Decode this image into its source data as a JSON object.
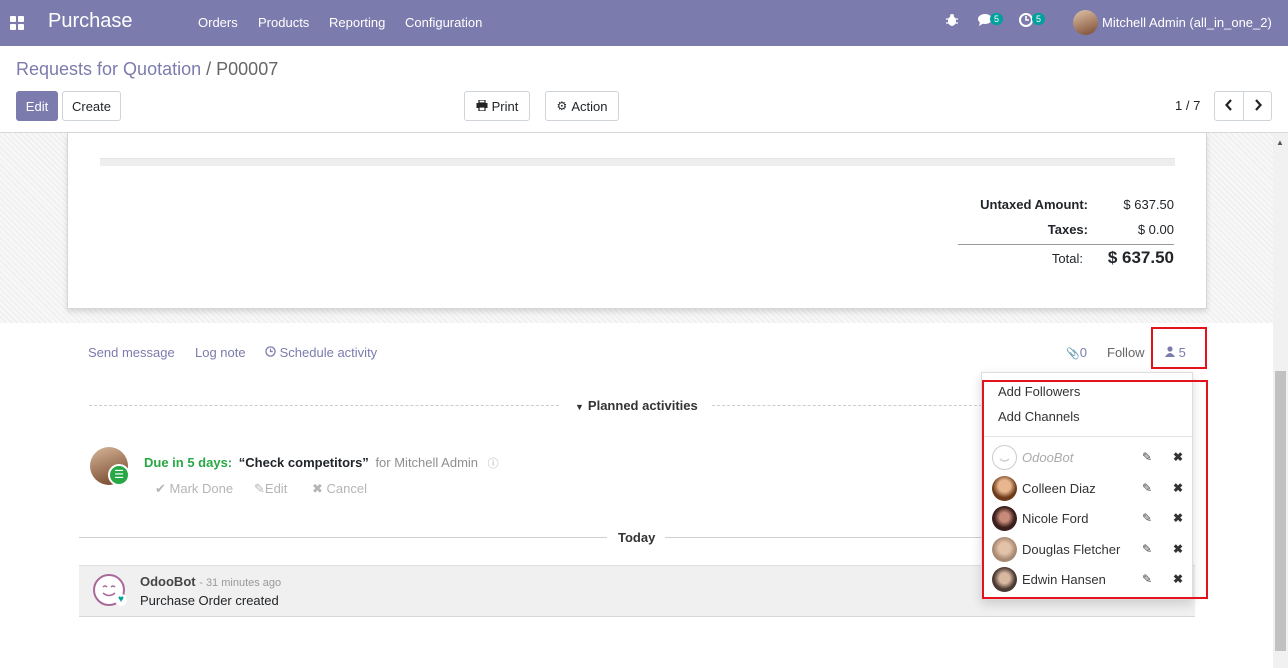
{
  "app": {
    "brand": "Purchase",
    "menu": [
      "Orders",
      "Products",
      "Reporting",
      "Configuration"
    ],
    "messages_count": "5",
    "activities_count": "5",
    "user": "Mitchell Admin (all_in_one_2)"
  },
  "breadcrumb": {
    "parent": "Requests for Quotation",
    "sep": "/",
    "current": "P00007"
  },
  "toolbar": {
    "edit": "Edit",
    "create": "Create",
    "print": "Print",
    "action": "Action",
    "pager": "1 / 7"
  },
  "totals": {
    "untaxed_label": "Untaxed Amount:",
    "untaxed": "$ 637.50",
    "taxes_label": "Taxes:",
    "taxes": "$ 0.00",
    "total_label": "Total:",
    "total": "$ 637.50"
  },
  "chatter": {
    "send": "Send message",
    "log": "Log note",
    "schedule": "Schedule activity",
    "attachments": "0",
    "follow": "Follow",
    "followers": "5"
  },
  "planned": {
    "title": "Planned activities",
    "due": "Due in 5 days:",
    "summary": "“Check competitors”",
    "for": "for Mitchell Admin",
    "mark_done": "Mark Done",
    "edit": "Edit",
    "cancel": "Cancel"
  },
  "today": "Today",
  "message": {
    "author": "OdooBot",
    "time": "- 31 minutes ago",
    "body": "Purchase Order created"
  },
  "followers_menu": {
    "add_followers": "Add Followers",
    "add_channels": "Add Channels",
    "list": [
      "OdooBot",
      "Colleen Diaz",
      "Nicole Ford",
      "Douglas Fletcher",
      "Edwin Hansen"
    ]
  },
  "colors": {
    "brand": "#7c7bad",
    "highlight": "#e4121d",
    "success": "#28a745"
  }
}
